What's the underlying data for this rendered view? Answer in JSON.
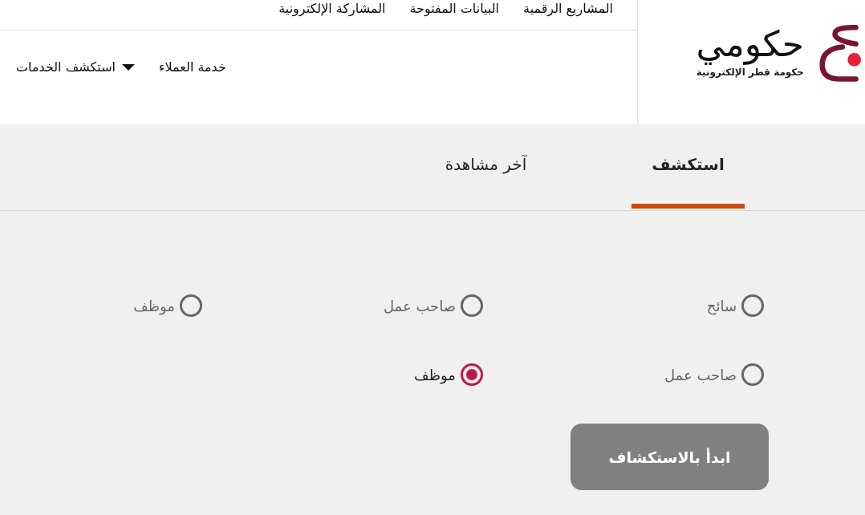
{
  "header": {
    "logo": {
      "title": "حكومي",
      "subtitle": "حكومة قطر الإلكترونية"
    },
    "top_links": [
      "المشاريع الرقمية",
      "البيانات المفتوحة",
      "المشاركة الإلكترونية"
    ],
    "nav": [
      {
        "label": "خدمة العملاء",
        "kind": "link"
      },
      {
        "label": "استكشف الخدمات",
        "kind": "dropdown"
      }
    ]
  },
  "tabs": [
    {
      "label": "استكشف",
      "selected": true
    },
    {
      "label": "آخر مشاهدة",
      "selected": false
    }
  ],
  "radio_groups": [
    {
      "options": [
        {
          "label": "سائح",
          "selected": false
        },
        {
          "label": "صاحب عمل",
          "selected": false
        },
        {
          "label": "موظف",
          "selected": false
        }
      ]
    },
    {
      "options": [
        {
          "label": "صاحب عمل",
          "selected": false
        },
        {
          "label": "موظف",
          "selected": true
        }
      ]
    }
  ],
  "start_button": "ابدأ بالاستكشاف"
}
